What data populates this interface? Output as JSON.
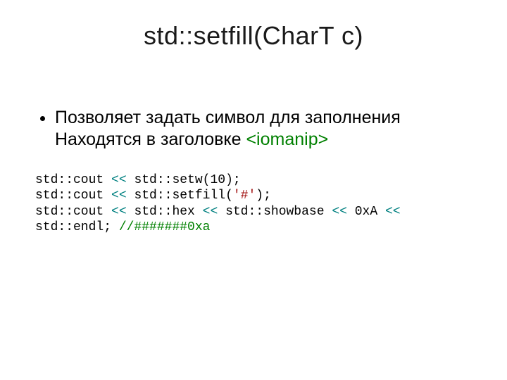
{
  "title": "std::setfill(CharT c)",
  "bullet": {
    "line1": "Позволяет задать символ для заполнения",
    "line2_a": "Находятся в заголовке ",
    "line2_hdr": "<iomanip>"
  },
  "code": {
    "l1_a": "std::cout ",
    "l1_op": "<<",
    "l1_b": " std::setw(",
    "l1_num": "10",
    "l1_c": ");",
    "l2_a": "std::cout ",
    "l2_op": "<<",
    "l2_b": " std::setfill(",
    "l2_char": "'#'",
    "l2_c": ");",
    "l3_a": "std::cout ",
    "l3_op1": "<<",
    "l3_b": " std::hex ",
    "l3_op2": "<<",
    "l3_c": " std::showbase ",
    "l3_op3": "<<",
    "l3_d": " ",
    "l3_hex": "0xA",
    "l3_e": " ",
    "l3_op4": "<<",
    "l4_a": "std::endl; ",
    "l4_comment": "//#######0xa"
  }
}
